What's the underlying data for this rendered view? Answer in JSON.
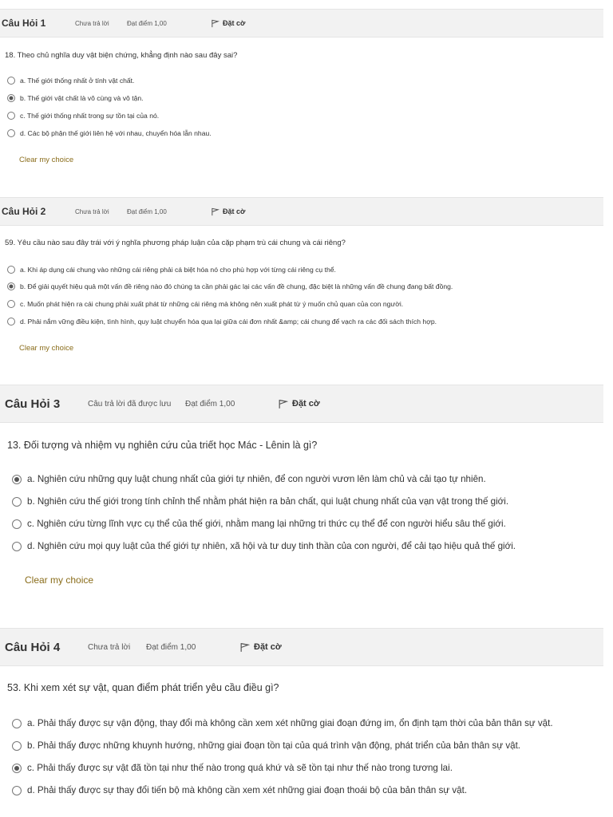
{
  "questions": [
    {
      "number_label": "Câu Hỏi 1",
      "state": "Chưa trả lời",
      "grade": "Đạt điểm 1,00",
      "flag_label": "Đặt cờ",
      "text": "18. Theo chủ nghĩa duy vật biện chứng, khẳng định nào sau đây sai?",
      "answers": [
        {
          "label": "a. Thế giới thống nhất ở tính vật chất.",
          "selected": false
        },
        {
          "label": "b. Thế giới vật chất là vô cùng và vô tận.",
          "selected": true
        },
        {
          "label": "c. Thế giới thống nhất trong sự tồn tại của nó.",
          "selected": false
        },
        {
          "label": "d. Các bộ phận thế giới liên hệ với nhau, chuyển hóa lẫn nhau.",
          "selected": false
        }
      ],
      "clear_label": "Clear my choice"
    },
    {
      "number_label": "Câu Hỏi 2",
      "state": "Chưa trả lời",
      "grade": "Đạt điểm 1,00",
      "flag_label": "Đặt cờ",
      "text": "59. Yêu cầu nào sau đây trái với ý nghĩa phương pháp luận của cặp phạm trù cái chung và cái riêng?",
      "answers": [
        {
          "label": "a. Khi áp dụng cái chung vào những cái riêng phải cá biệt hóa nó cho phù hợp với từng cái riêng cụ thể.",
          "selected": false
        },
        {
          "label": "b. Để giải quyết hiệu quả một vấn đề riêng nào đó chúng ta cần phải gác lại các vấn đề chung, đặc biệt là những vấn đề chung đang bất đồng.",
          "selected": true
        },
        {
          "label": "c. Muốn phát hiện ra cái chung phải xuất phát từ những cái riêng mà không nên xuất phát từ ý muốn chủ quan của con người.",
          "selected": false
        },
        {
          "label": "d. Phải nắm vững điều kiện, tình hình, quy luật chuyển hóa qua lại giữa cái đơn nhất &amp; cái chung để vạch ra các đối sách thích hợp.",
          "selected": false
        }
      ],
      "clear_label": "Clear my choice"
    },
    {
      "number_label": "Câu Hỏi 3",
      "state": "Câu trả lời đã được lưu",
      "grade": "Đạt điểm 1,00",
      "flag_label": "Đặt cờ",
      "text": "13. Đối tượng và nhiệm vụ nghiên cứu của triết học Mác - Lênin là gì?",
      "answers": [
        {
          "label": "a. Nghiên cứu những quy luật chung nhất của giới tự nhiên, để con người vươn lên làm chủ và cải tạo tự nhiên.",
          "selected": true
        },
        {
          "label": "b. Nghiên cứu thế giới trong tính chỉnh thể nhằm phát hiện ra bản chất, qui luật chung nhất của vạn vật trong thế giới.",
          "selected": false
        },
        {
          "label": "c. Nghiên cứu từng lĩnh vực cụ thể của thế giới, nhằm mang lại những tri thức cụ thể để con người hiểu sâu thế giới.",
          "selected": false
        },
        {
          "label": "d. Nghiên cứu mọi quy luật của thế giới tự nhiên, xã hội và tư duy tinh thần của con người, để cải tạo hiệu quả thế giới.",
          "selected": false
        }
      ],
      "clear_label": "Clear my choice"
    },
    {
      "number_label": "Câu Hỏi 4",
      "state": "Chưa trả lời",
      "grade": "Đạt điểm 1,00",
      "flag_label": "Đặt cờ",
      "text": "53. Khi xem xét sự vật, quan điểm phát triển yêu cầu điều gì?",
      "answers": [
        {
          "label": "a. Phải thấy được sự vận động, thay đổi mà không cần xem xét những giai đoạn đứng im, ổn định tạm thời của bản thân sự vật.",
          "selected": false
        },
        {
          "label": "b. Phải thấy được những khuynh hướng, những giai đoạn tồn tại của quá trình vận động, phát triển của bản thân sự vật.",
          "selected": false
        },
        {
          "label": "c. Phải thấy được sự vật đã tồn tại như thế nào trong quá khứ và sẽ tồn tại như thế nào trong tương lai.",
          "selected": true
        },
        {
          "label": "d. Phải thấy được sự thay đổi tiến bộ mà không cần xem xét những giai đoạn thoái bộ của bản thân sự vật.",
          "selected": false
        }
      ]
    }
  ]
}
